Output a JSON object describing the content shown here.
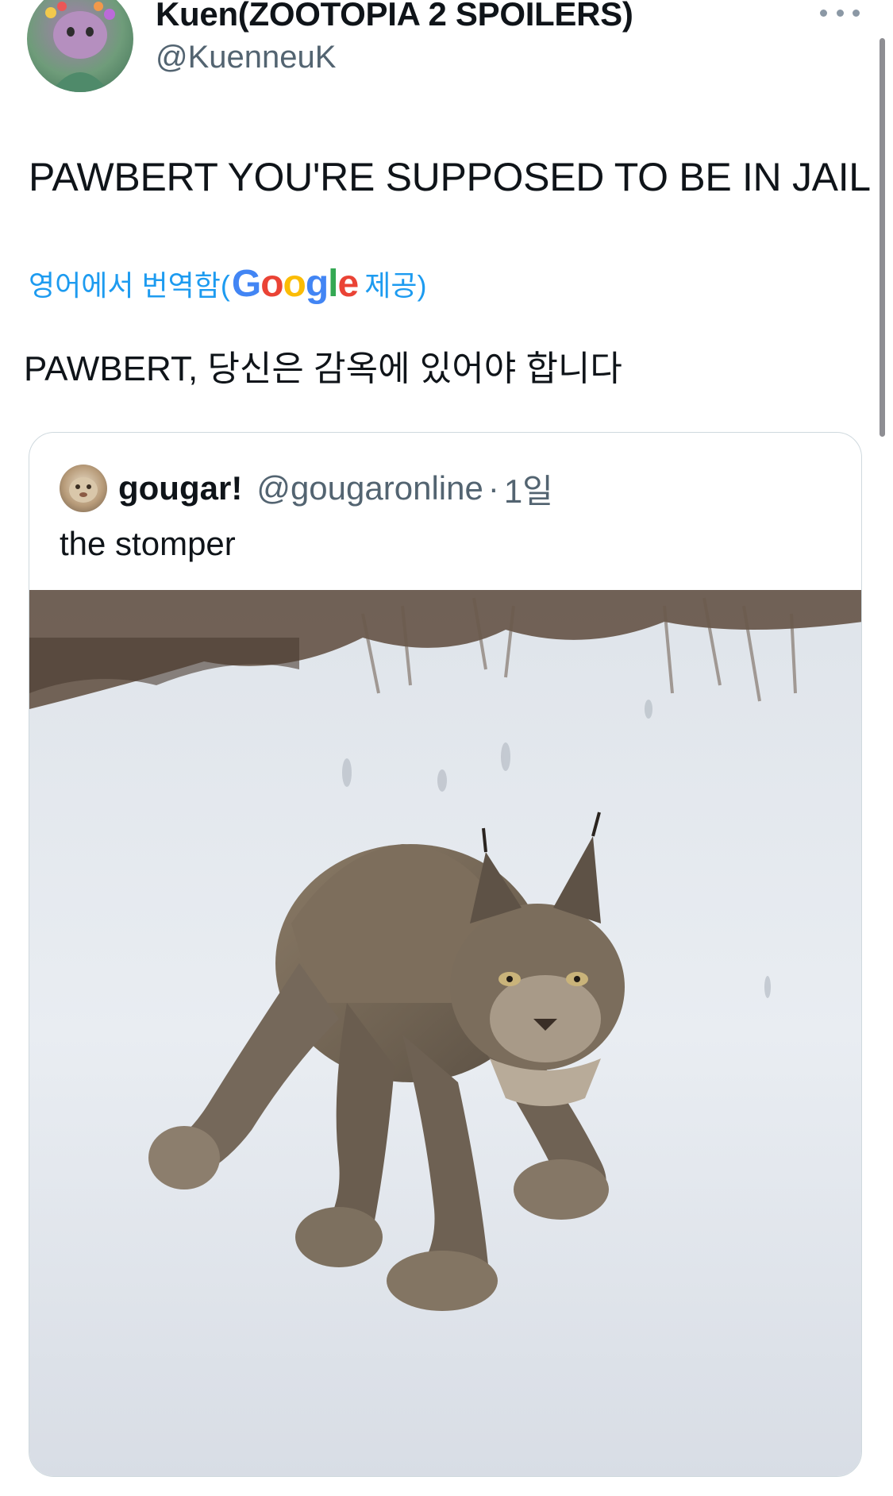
{
  "tweet": {
    "display_name": "Kuen(ZOOTOPIA 2 SPOILERS)",
    "handle": "@KuenneuK",
    "text": "PAWBERT YOU'RE SUPPOSED TO BE IN JAIL",
    "translation_label": "영어에서 번역함(",
    "translation_provider": "Google",
    "translation_suffix": " 제공)",
    "translated_text": "PAWBERT, 당신은 감옥에 있어야 합니다"
  },
  "quoted_tweet": {
    "display_name": "gougar!",
    "handle": "@gougaronline",
    "separator": "·",
    "time": "1일",
    "text": "the stomper",
    "media": "photo of a lynx walking in snow"
  },
  "icons": {
    "more": "more-horizontal-icon"
  },
  "colors": {
    "link": "#1d9bf0",
    "secondary_text": "#536471",
    "border": "#cfd9de"
  }
}
